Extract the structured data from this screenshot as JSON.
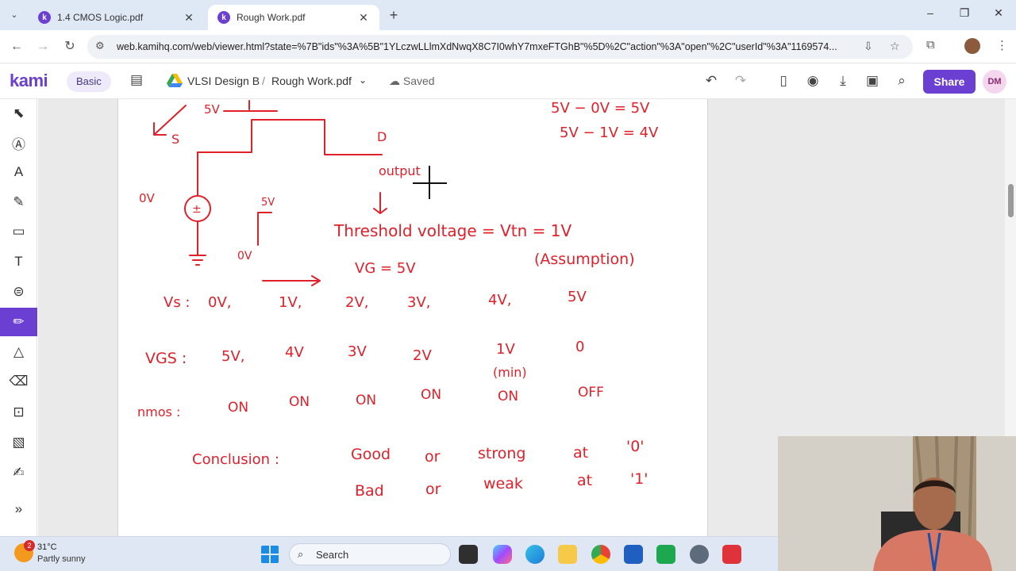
{
  "browser": {
    "tabs": [
      {
        "title": "1.4 CMOS Logic.pdf",
        "active": false
      },
      {
        "title": "Rough Work.pdf",
        "active": true
      }
    ],
    "url": "web.kamihq.com/web/viewer.html?state=%7B\"ids\"%3A%5B\"1YLczwLLlmXdNwqX8C7I0whY7mxeFTGhB\"%5D%2C\"action\"%3A\"open\"%2C\"userId\"%3A\"1169574..."
  },
  "kami": {
    "logo": "kami",
    "plan": "Basic",
    "folder": "VLSI Design B",
    "separator": "/",
    "file": "Rough Work.pdf",
    "status": "Saved",
    "share_label": "Share",
    "avatar_initials": "DM",
    "accent": "#6b3fd1"
  },
  "notes": {
    "circuit": {
      "v_gate": "5V",
      "source": "S",
      "drain": "D",
      "output": "output",
      "v_source": "0V",
      "step_high": "5V",
      "step_low": "0V"
    },
    "calc_line1": "5V − 0V = 5V",
    "calc_line2": "5V − 1V = 4V",
    "threshold": "Threshold voltage = Vtn = 1V",
    "assumption": "(Assumption)",
    "vg": "VG = 5V",
    "vs_label": "Vs :",
    "vs_values": [
      "0V,",
      "1V,",
      "2V,",
      "3V,",
      "4V,",
      "5V"
    ],
    "vgs_label": "VGS :",
    "vgs_values": [
      "5V,",
      "4V",
      "3V",
      "2V",
      "1V",
      "0"
    ],
    "vgs_min": "(min)",
    "nmos_label": "nmos :",
    "nmos_values": [
      "ON",
      "ON",
      "ON",
      "ON",
      "ON",
      "OFF"
    ],
    "conclusion_label": "Conclusion :",
    "conclusion_line1": [
      "Good",
      "or",
      "strong",
      "at",
      "'0'"
    ],
    "conclusion_line2": [
      "Bad",
      "or",
      "weak",
      "at",
      "'1'"
    ],
    "ink_color": "#e0202a"
  },
  "taskbar": {
    "weather_badge": "2",
    "temperature": "31°C",
    "condition": "Partly sunny",
    "search_placeholder": "Search"
  }
}
